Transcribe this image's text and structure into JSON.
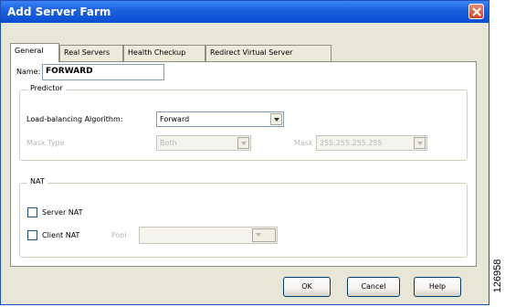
{
  "window": {
    "title": "Add Server Farm",
    "close_icon": "close-icon",
    "accent": "#0b4fd1"
  },
  "tabs": [
    {
      "label": "General",
      "active": true
    },
    {
      "label": "Real Servers",
      "active": false
    },
    {
      "label": "Health Checkup",
      "active": false
    },
    {
      "label": "Redirect Virtual Server",
      "active": false
    }
  ],
  "general": {
    "name_label": "Name:",
    "name_value": "FORWARD",
    "predictor": {
      "title": "Predictor",
      "algorithm_label": "Load-balancing Algorithm:",
      "algorithm_value": "Forward",
      "mask_type_label": "Mask Type",
      "mask_type_value": "Both",
      "mask_label": "Mask",
      "mask_value": "255.255.255.255"
    },
    "nat": {
      "title": "NAT",
      "server_nat_label": "Server NAT",
      "server_nat_checked": false,
      "client_nat_label": "Client NAT",
      "client_nat_checked": false,
      "pool_label": "Pool",
      "pool_value": ""
    }
  },
  "buttons": {
    "ok": "OK",
    "cancel": "Cancel",
    "help": "Help"
  },
  "figure_code": "126958"
}
